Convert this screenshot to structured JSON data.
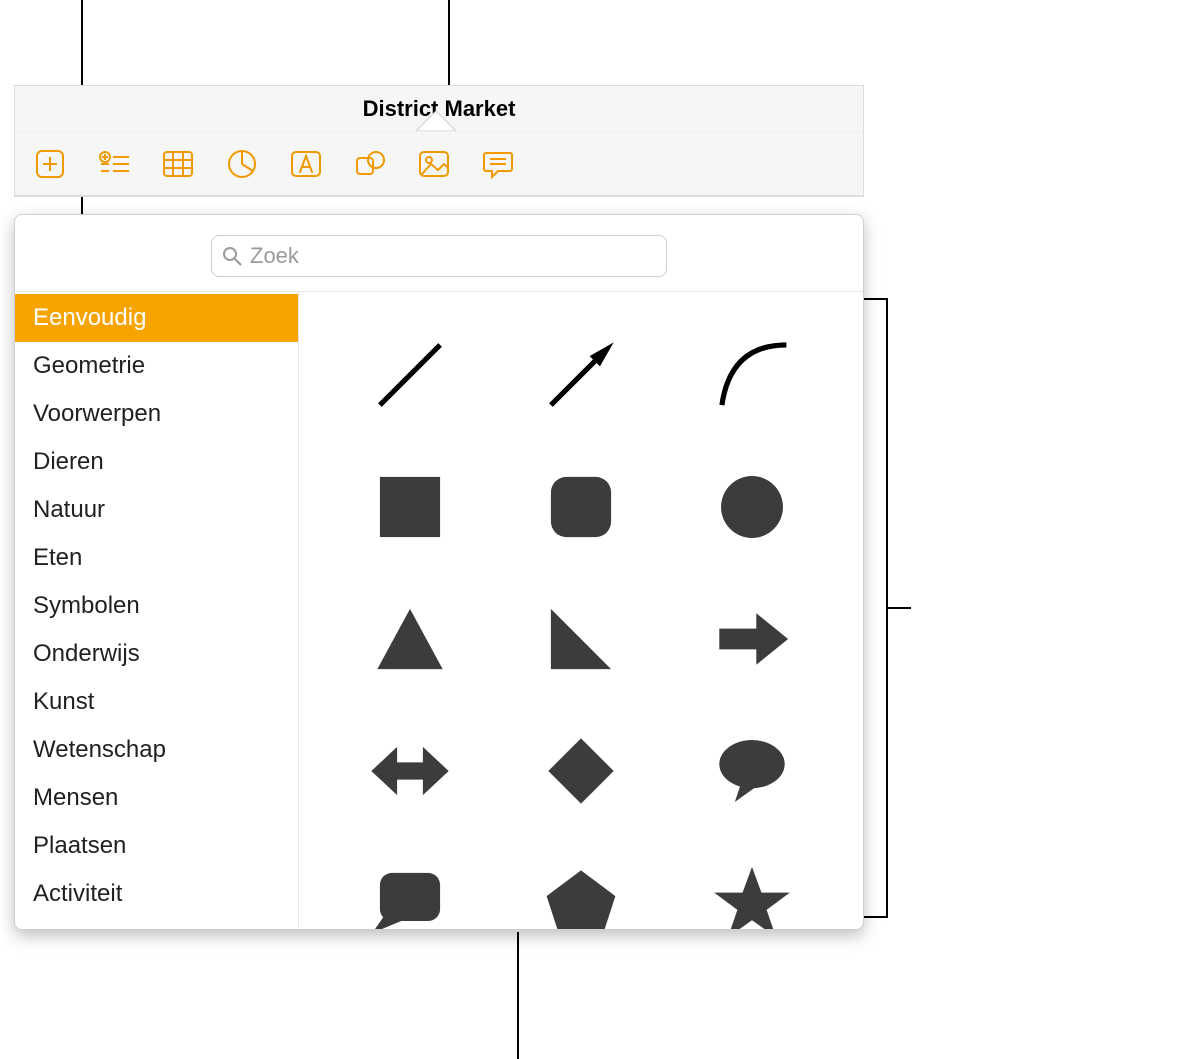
{
  "app": {
    "title": "District Market"
  },
  "toolbar": {
    "icons": [
      "add-icon",
      "list-icon",
      "table-icon",
      "chart-icon",
      "text-icon",
      "shape-icon",
      "media-icon",
      "comment-icon"
    ]
  },
  "search": {
    "placeholder": "Zoek",
    "value": ""
  },
  "categories": [
    "Eenvoudig",
    "Geometrie",
    "Voorwerpen",
    "Dieren",
    "Natuur",
    "Eten",
    "Symbolen",
    "Onderwijs",
    "Kunst",
    "Wetenschap",
    "Mensen",
    "Plaatsen",
    "Activiteit"
  ],
  "selected_category_index": 0,
  "shapes": [
    "line",
    "arrow-line",
    "curve",
    "square",
    "rounded-square",
    "circle",
    "triangle",
    "right-triangle",
    "arrow-right",
    "double-arrow",
    "diamond",
    "speech-bubble",
    "quote-bubble",
    "pentagon",
    "star"
  ],
  "colors": {
    "accent": "#f7a400",
    "toolbar_icon": "#f09a00",
    "shape_fill": "#3c3c3c"
  }
}
